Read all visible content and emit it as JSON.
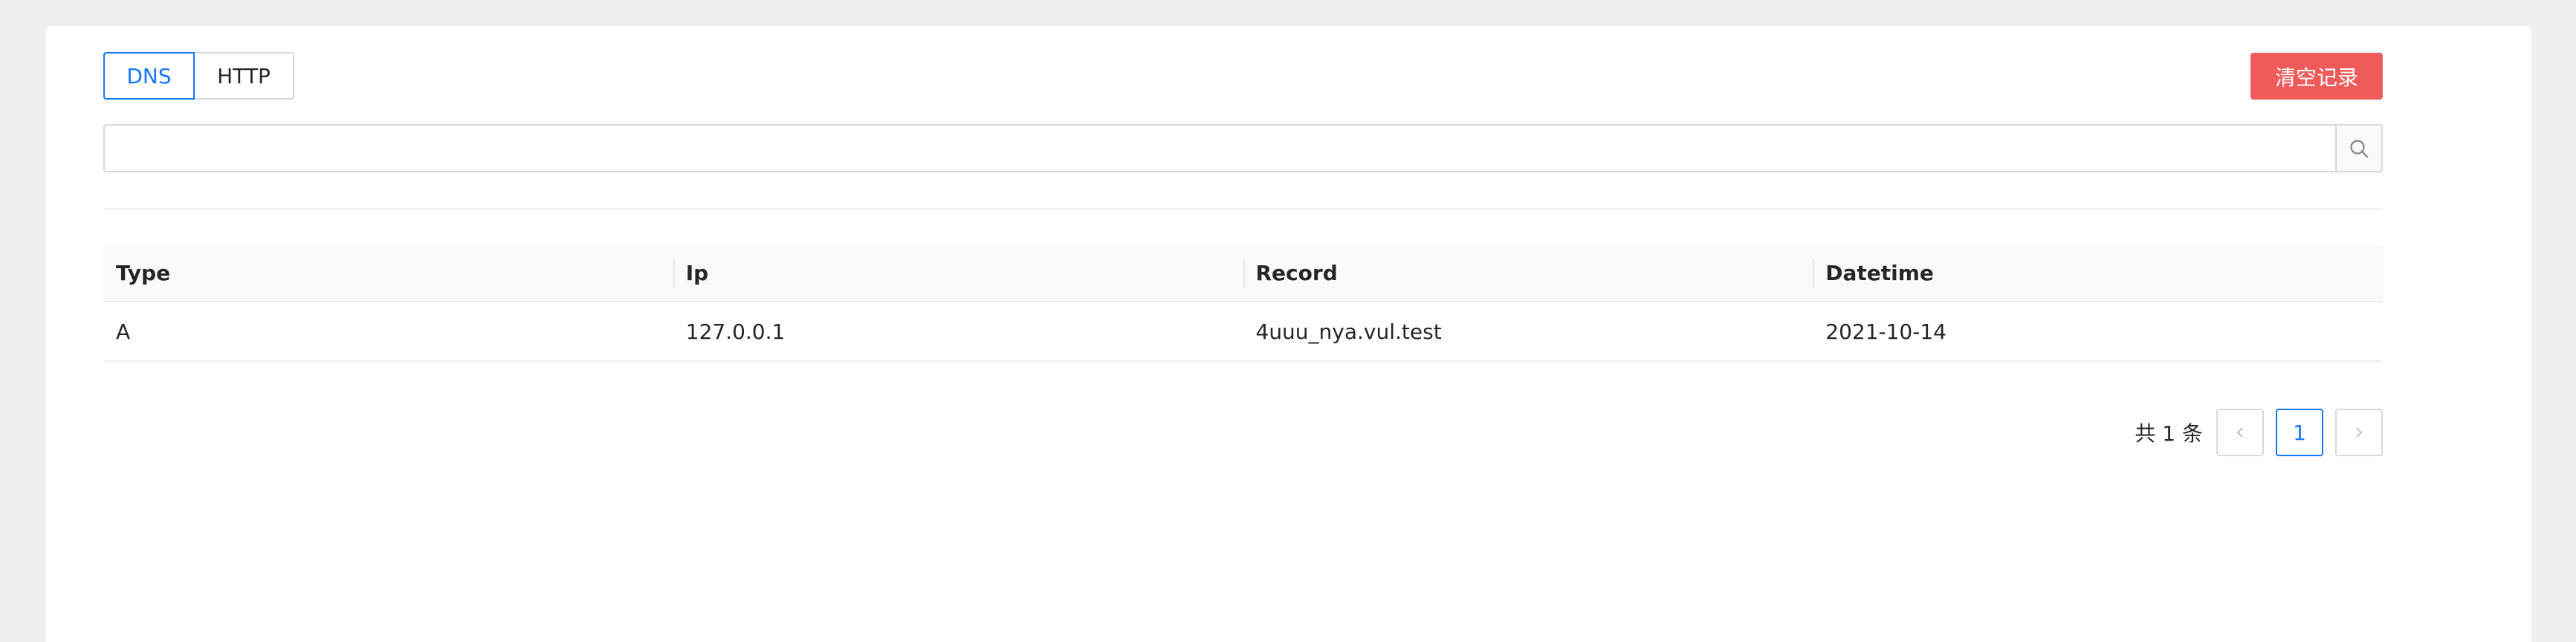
{
  "tabs": [
    "DNS",
    "HTTP"
  ],
  "active_tab": "DNS",
  "clear_button": "清空记录",
  "search": {
    "placeholder": "",
    "value": ""
  },
  "table": {
    "columns": [
      "Type",
      "Ip",
      "Record",
      "Datetime"
    ],
    "rows": [
      [
        "A",
        "127.0.0.1",
        "4uuu_nya.vul.test",
        "2021-10-14"
      ]
    ]
  },
  "pagination": {
    "total_text": "共 1 条",
    "current_page": "1"
  },
  "colors": {
    "primary": "#1677ff",
    "danger": "#ef5b5b",
    "background": "#f0f0f0"
  },
  "icons": {
    "search": "search-icon",
    "prev": "chevron-left-icon",
    "next": "chevron-right-icon"
  }
}
